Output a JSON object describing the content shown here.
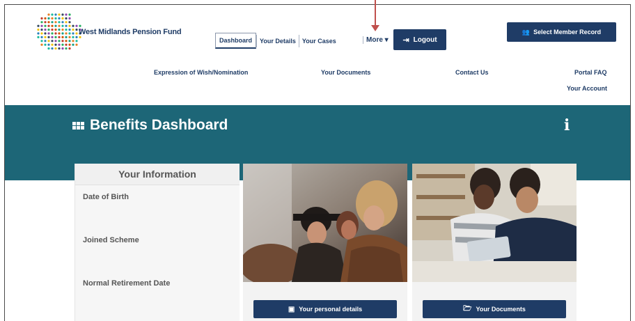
{
  "header": {
    "brand": "West Midlands Pension Fund",
    "tabs": [
      {
        "label": "Dashboard"
      },
      {
        "label": "Your Details"
      },
      {
        "label": "Your Cases"
      }
    ],
    "more_label": "More ▾",
    "logout_label": "Logout",
    "member_button_label": "Select Member Record"
  },
  "subnav": {
    "links": [
      "Expression of Wish/Nomination",
      "Your Documents",
      "Contact Us",
      "Portal FAQ",
      "Your Account"
    ]
  },
  "banner": {
    "title": "Benefits Dashboard",
    "info_icon": "i"
  },
  "info_card": {
    "title": "Your Information",
    "rows": [
      "Date of Birth",
      "Joined Scheme",
      "Normal Retirement Date"
    ]
  },
  "cards": [
    {
      "button_label": "Your personal details",
      "icon": "id-card-icon"
    },
    {
      "button_label": "Your Documents",
      "icon": "folder-icon"
    }
  ],
  "colors": {
    "navy": "#1f3c66",
    "teal": "#1d6677",
    "annotation_red": "#c0504d"
  }
}
